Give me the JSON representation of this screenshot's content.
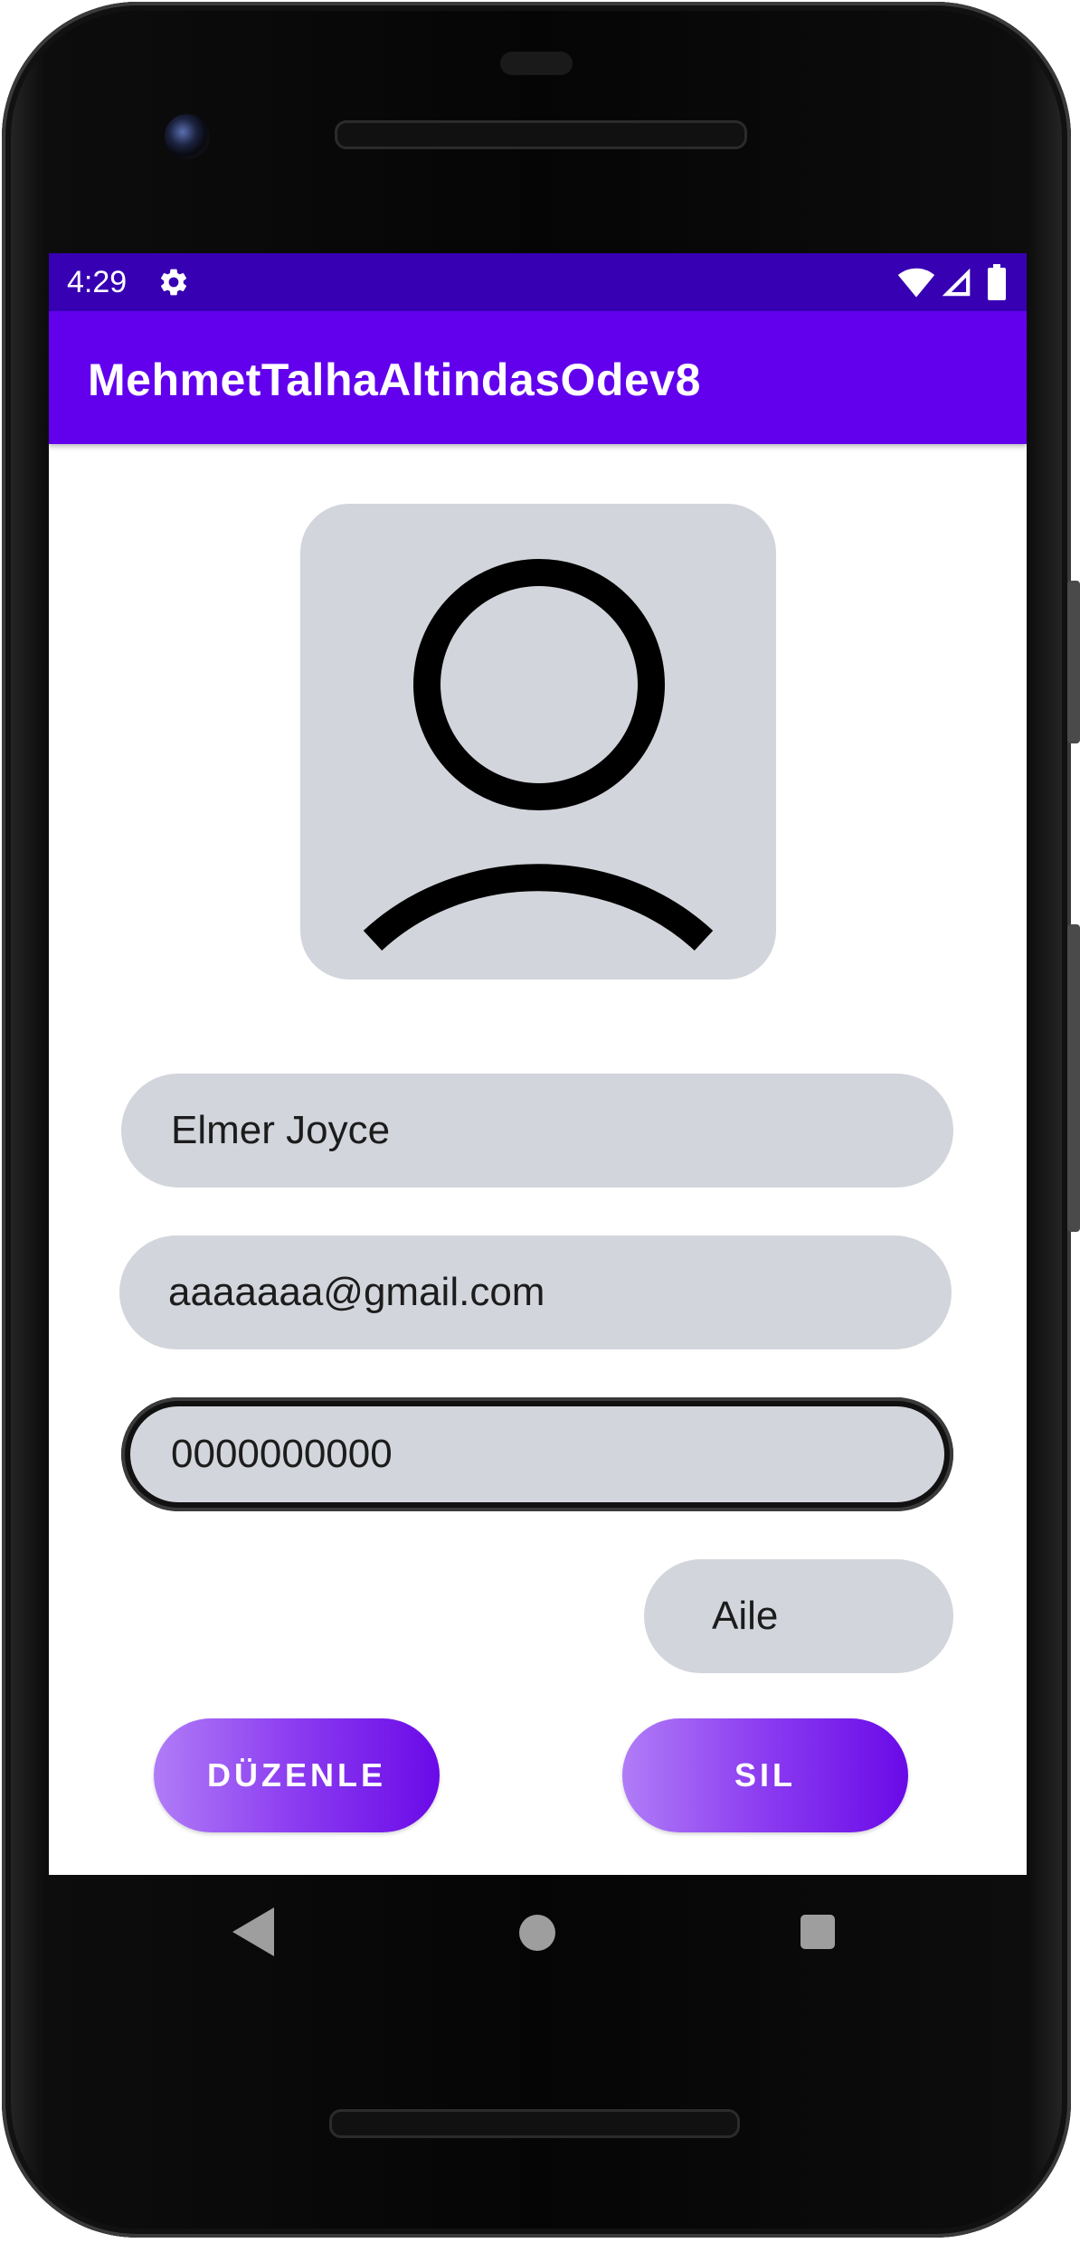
{
  "status_bar": {
    "time": "4:29",
    "icons": [
      "gear-icon",
      "wifi-icon",
      "cell-signal-icon",
      "battery-icon"
    ],
    "background": "#3700b3"
  },
  "app_bar": {
    "title": "MehmetTalhaAltindasOdev8",
    "background": "#6200ee"
  },
  "avatar": {
    "icon": "person-icon",
    "background": "#d3d5dc"
  },
  "form": {
    "name": "Elmer Joyce",
    "email": "aaaaaaa@gmail.com",
    "phone": "0000000000",
    "category": "Aile"
  },
  "actions": {
    "edit_label": "DÜZENLE",
    "delete_label": "SIL",
    "gradient_start": "#b07cf7",
    "gradient_end": "#6a0ae8"
  },
  "nav_bar": {
    "icons": [
      "back-icon",
      "home-icon",
      "recents-icon"
    ]
  }
}
